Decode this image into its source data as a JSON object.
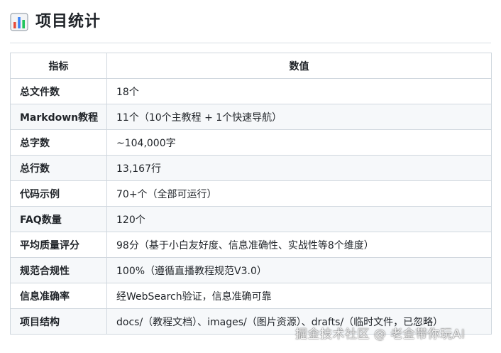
{
  "heading": {
    "icon": "bar-chart-emoji-icon",
    "title": "项目统计"
  },
  "table": {
    "headers": [
      "指标",
      "数值"
    ],
    "rows": [
      {
        "metric": "总文件数",
        "value": "18个"
      },
      {
        "metric": "Markdown教程",
        "value": "11个（10个主教程 + 1个快速导航）"
      },
      {
        "metric": "总字数",
        "value": "~104,000字"
      },
      {
        "metric": "总行数",
        "value": "13,167行"
      },
      {
        "metric": "代码示例",
        "value": "70+个（全部可运行）"
      },
      {
        "metric": "FAQ数量",
        "value": "120个"
      },
      {
        "metric": "平均质量评分",
        "value": "98分（基于小白友好度、信息准确性、实战性等8个维度）"
      },
      {
        "metric": "规范合规性",
        "value": "100%（遵循直播教程规范V3.0）"
      },
      {
        "metric": "信息准确率",
        "value": "经WebSearch验证，信息准确可靠"
      },
      {
        "metric": "项目结构",
        "value": "docs/（教程文档）、images/（图片资源）、drafts/（临时文件，已忽略）"
      }
    ]
  },
  "watermark": {
    "text": "掘金技术社区 @ 老金带你玩AI"
  },
  "colors": {
    "text": "#1f2328",
    "border": "#d0d7de",
    "stripe": "#f6f8fa",
    "rule": "#d8dee4"
  }
}
